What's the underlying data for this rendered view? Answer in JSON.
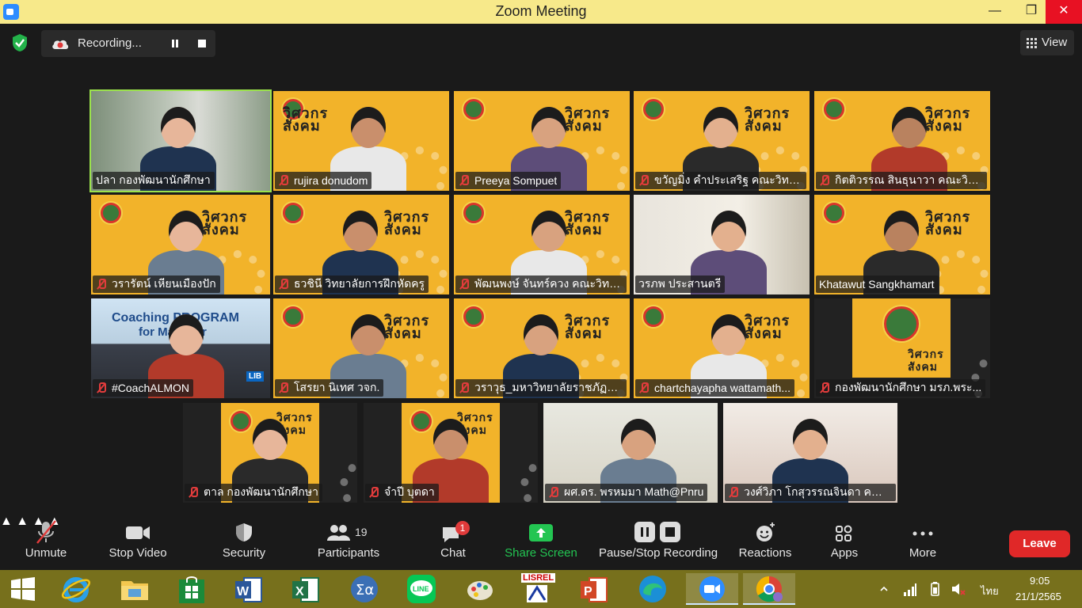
{
  "window": {
    "title": "Zoom Meeting",
    "min": "—",
    "max": "❐",
    "close": "✕"
  },
  "recording": {
    "label": "Recording..."
  },
  "view": {
    "label": "View"
  },
  "participants": [
    {
      "name": "ปลา  กองพัฒนานักศึกษา",
      "muted": false,
      "active": true
    },
    {
      "name": "rujira donudom",
      "muted": true
    },
    {
      "name": "Preeya Sompuet",
      "muted": true
    },
    {
      "name": "ขวัญมิ่ง คำประเสริฐ คณะวิทยา...",
      "muted": true
    },
    {
      "name": "กิตติวรรณ สินธุนาวา คณะวิท...",
      "muted": true
    },
    {
      "name": "วรารัตน์ เหียนเมืองปัก",
      "muted": true
    },
    {
      "name": "ธวชินี  วิทยาลัยการฝึกหัดครู",
      "muted": true
    },
    {
      "name": "พัฒนพงษ์ จันทร์ควง คณะวิทย...",
      "muted": true
    },
    {
      "name": "วรภพ ประสานตรี",
      "muted": false
    },
    {
      "name": "Khatawut Sangkhamart",
      "muted": false
    },
    {
      "name": "#CoachALMON",
      "muted": true,
      "slide": "Coaching PROGRAM",
      "slide2": "for Manager",
      "logo": "LIB"
    },
    {
      "name": "โสรยา นิเทศ วจก.",
      "muted": true
    },
    {
      "name": "วราวุธ_มหาวิทยาลัยราชภัฏพร...",
      "muted": true
    },
    {
      "name": "chartchayapha wattamath...",
      "muted": true
    },
    {
      "name": "กองพัฒนานักศึกษา มรภ.พระ...",
      "muted": true
    },
    {
      "name": "ตาล กองพัฒนานักศึกษา",
      "muted": true
    },
    {
      "name": "จำปี บุตดา",
      "muted": true
    },
    {
      "name": "ผศ.ดร. พรหมมา Math@Pnru",
      "muted": true
    },
    {
      "name": "วงศ์วิภา  โกสุวรรณจินดา คณะ...",
      "muted": true
    }
  ],
  "brand_text": {
    "line1": "วิศวกร",
    "line2": "สังคม"
  },
  "toolbar": {
    "unmute": "Unmute",
    "stop_video": "Stop Video",
    "security": "Security",
    "participants": "Participants",
    "participants_count": "19",
    "chat": "Chat",
    "chat_badge": "1",
    "share_screen": "Share Screen",
    "pause_stop": "Pause/Stop Recording",
    "reactions": "Reactions",
    "apps": "Apps",
    "more": "More",
    "leave": "Leave"
  },
  "taskbar": {
    "lang": "ไทย",
    "time": "9:05",
    "date": "21/1/2565",
    "lisrel": "LISREL"
  },
  "colors": {
    "active_speaker": "#9be24d",
    "leave": "#e02828",
    "share": "#23c552",
    "title_bg": "#f7e98a",
    "taskbar": "#77701c"
  }
}
